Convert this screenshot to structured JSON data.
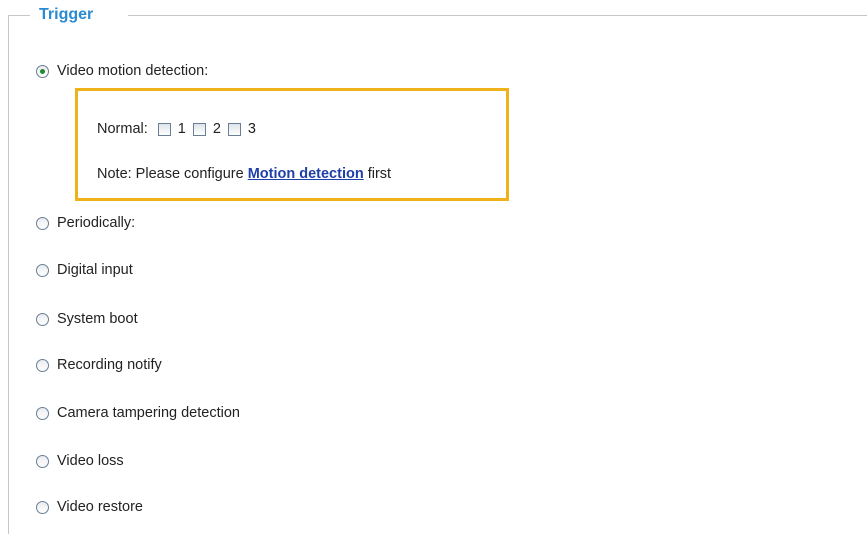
{
  "legend": "Trigger",
  "options": [
    {
      "label": "Video motion detection:",
      "selected": true
    },
    {
      "label": "Periodically:",
      "selected": false
    },
    {
      "label": "Digital input",
      "selected": false
    },
    {
      "label": "System boot",
      "selected": false
    },
    {
      "label": "Recording notify",
      "selected": false
    },
    {
      "label": "Camera tampering detection",
      "selected": false
    },
    {
      "label": "Video loss",
      "selected": false
    },
    {
      "label": "Video restore",
      "selected": false
    }
  ],
  "motion": {
    "normal_label": "Normal:",
    "windows": [
      {
        "label": "1",
        "checked": false
      },
      {
        "label": "2",
        "checked": false
      },
      {
        "label": "3",
        "checked": false
      }
    ],
    "note_prefix": "Note: Please configure",
    "note_link": "Motion detection",
    "note_suffix": "first"
  },
  "colors": {
    "legend": "#2a8bd0",
    "highlight_border": "#f0b21b",
    "link": "#1f3fa8",
    "radio_dot": "#1f8a2e"
  }
}
